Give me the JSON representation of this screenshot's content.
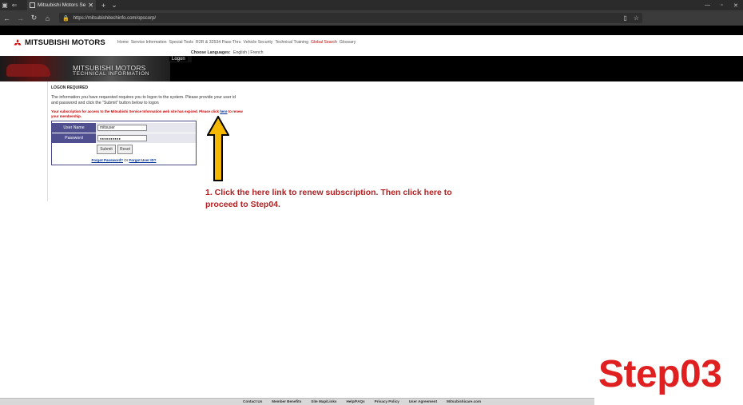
{
  "browser": {
    "tab_title": "Mitsubishi Motors Servi",
    "url": "https://mitsubishitechinfo.com/opscorp/",
    "colors": {
      "chrome": "#3b3b3b",
      "tabbar": "#2b2b2b"
    }
  },
  "site": {
    "brand": "MITSUBISHI MOTORS",
    "nav": [
      {
        "label": "Home"
      },
      {
        "label": "Service Information"
      },
      {
        "label": "Special Tools"
      },
      {
        "label": "R2R & 32534 Pass-Thru"
      },
      {
        "label": "Vehicle Security"
      },
      {
        "label": "Technical Training"
      },
      {
        "label": "Global Search"
      },
      {
        "label": "Glossary"
      }
    ],
    "languages": {
      "label": "Choose Languages:",
      "english": "English",
      "sep": "|",
      "french": "French"
    },
    "banner": {
      "title_line1": "MITSUBISHI MOTORS",
      "title_line2": "TECHNICAL INFORMATION",
      "logon": "Logon"
    }
  },
  "logon": {
    "heading": "LOGON REQUIRED",
    "info": "The information you have requested requires you to logon to the system. Please provide your user id and password and click the \"Submit\" button below to logon",
    "expired_before": "Your subscription for access to the Mitsubishi Service Information web site has expired. Please click ",
    "expired_link": "here",
    "expired_after": " to renew your membership.",
    "username_label": "User Name",
    "username_value": "mitsuser",
    "password_label": "Password",
    "password_value": "●●●●●●●●●●",
    "submit": "Submit",
    "reset": "Reset",
    "forgot_password": "Forgot Password?",
    "forgot_or": " Or ",
    "forgot_userid": "Forgot User ID?"
  },
  "annotation": {
    "text": "1. Click the here link to renew subscription. Then click here to proceed to Step04.",
    "color": "#b22222",
    "arrow_color": "#f5b800"
  },
  "footer": {
    "links": [
      "Contact Us",
      "Member Benefits",
      "Site Map/Links",
      "Help/FAQs",
      "Privacy Policy",
      "User Agreement",
      "Mitsubishicare.com"
    ]
  },
  "step": {
    "label": "Step03",
    "color": "#e02020"
  }
}
